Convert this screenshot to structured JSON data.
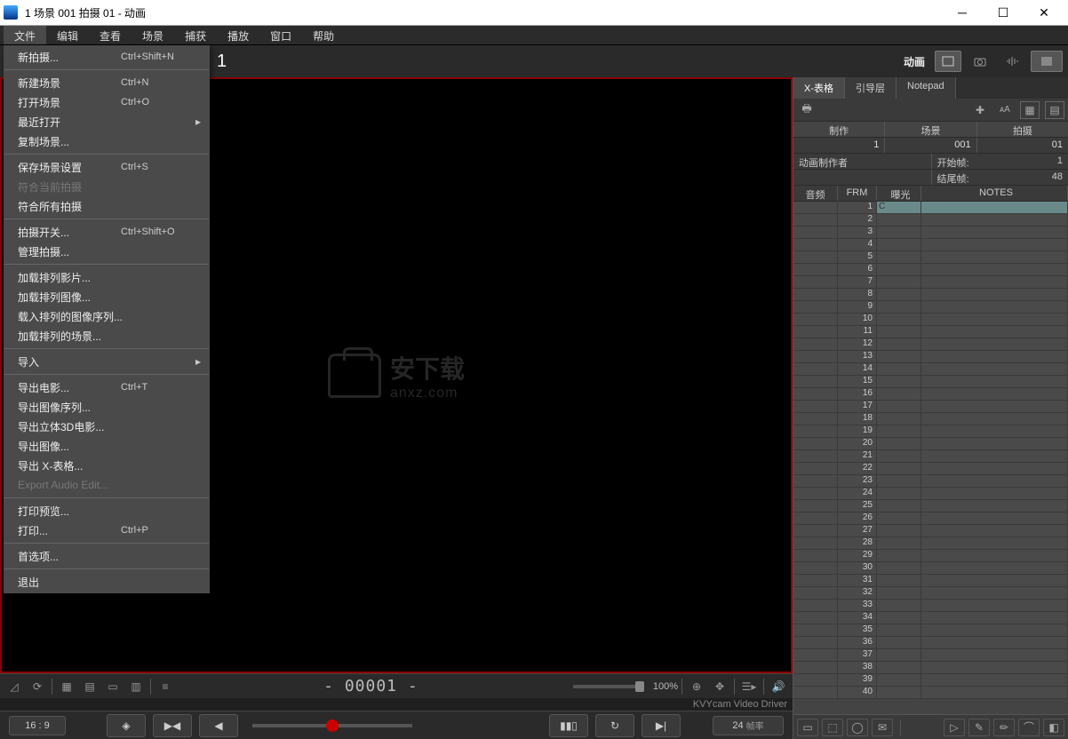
{
  "titlebar": {
    "title": "1  场景 001  拍摄 01 - 动画"
  },
  "menubar": [
    "文件",
    "编辑",
    "查看",
    "场景",
    "捕获",
    "播放",
    "窗口",
    "帮助"
  ],
  "file_menu": [
    {
      "label": "新拍摄...",
      "shortcut": "Ctrl+Shift+N"
    },
    {
      "sep": true
    },
    {
      "label": "新建场景",
      "shortcut": "Ctrl+N"
    },
    {
      "label": "打开场景",
      "shortcut": "Ctrl+O"
    },
    {
      "label": "最近打开",
      "submenu": true
    },
    {
      "label": "复制场景..."
    },
    {
      "sep": true
    },
    {
      "label": "保存场景设置",
      "shortcut": "Ctrl+S"
    },
    {
      "label": "符合当前拍摄",
      "disabled": true
    },
    {
      "label": "符合所有拍摄"
    },
    {
      "sep": true
    },
    {
      "label": "拍摄开关...",
      "shortcut": "Ctrl+Shift+O"
    },
    {
      "label": "管理拍摄..."
    },
    {
      "sep": true
    },
    {
      "label": "加载排列影片..."
    },
    {
      "label": "加载排列图像..."
    },
    {
      "label": "载入排列的图像序列..."
    },
    {
      "label": "加载排列的场景..."
    },
    {
      "sep": true
    },
    {
      "label": "导入",
      "submenu": true
    },
    {
      "sep": true
    },
    {
      "label": "导出电影...",
      "shortcut": "Ctrl+T"
    },
    {
      "label": "导出图像序列..."
    },
    {
      "label": "导出立体3D电影..."
    },
    {
      "label": "导出图像..."
    },
    {
      "label": "导出 X-表格..."
    },
    {
      "label": "Export Audio Edit...",
      "disabled": true
    },
    {
      "sep": true
    },
    {
      "label": "打印预览..."
    },
    {
      "label": "打印...",
      "shortcut": "Ctrl+P"
    },
    {
      "sep": true
    },
    {
      "label": "首选项..."
    },
    {
      "sep": true
    },
    {
      "label": "退出"
    }
  ],
  "top_right": {
    "mode": "动画"
  },
  "right": {
    "tabs": [
      "X-表格",
      "引导层",
      "Notepad"
    ],
    "hdr": {
      "c1": "制作",
      "c2": "场景",
      "c3": "拍摄"
    },
    "vals": {
      "v1": "1",
      "v2": "001",
      "v3": "01"
    },
    "creator_label": "动画制作者",
    "start_frame_label": "开始帧:",
    "start_frame_val": "1",
    "end_frame_label": "结尾帧:",
    "end_frame_val": "48",
    "grid_hdr": {
      "audio": "音频",
      "frm": "FRM",
      "exp": "曝光",
      "notes": "NOTES"
    }
  },
  "viewport": {
    "frame": "- 00001 -",
    "zoom": "100%",
    "status": "KVYcam Video Driver"
  },
  "transport": {
    "aspect": "16 : 9",
    "fps": "24",
    "fps_label": "帧率"
  },
  "watermark": {
    "l1": "安下载",
    "l2": "anxz.com"
  }
}
